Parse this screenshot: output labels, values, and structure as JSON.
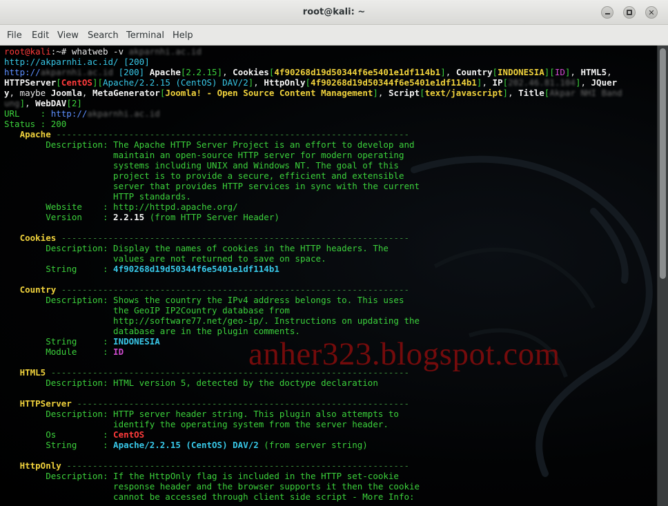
{
  "window": {
    "title": "root@kali: ~",
    "buttons": {
      "minimize": "minimize",
      "maximize": "maximize",
      "close": "✕"
    }
  },
  "menu": [
    "File",
    "Edit",
    "View",
    "Search",
    "Terminal",
    "Help"
  ],
  "watermark": "anher323.blogspot.com",
  "terminal_lines": [
    [
      [
        "r",
        "root@kali"
      ],
      [
        "w",
        ":~# whatweb -v "
      ],
      [
        "blur",
        "akparnhi.ac.id"
      ]
    ],
    [
      [
        "c",
        "http://akparnhi.ac.id/ [200]"
      ]
    ],
    [
      [
        "bl",
        "http://"
      ],
      [
        "blur",
        "akparnhi.ac.id"
      ],
      [
        "c",
        " [200] "
      ],
      [
        "wb",
        "Apache"
      ],
      [
        "g",
        "["
      ],
      [
        "g",
        "2.2.15"
      ],
      [
        "g",
        "]"
      ],
      [
        "w",
        ", "
      ],
      [
        "wb",
        "Cookies"
      ],
      [
        "g",
        "["
      ],
      [
        "yb",
        "4f90268d19d50344f6e5401e1df114b1"
      ],
      [
        "g",
        "]"
      ],
      [
        "w",
        ", "
      ],
      [
        "wb",
        "Country"
      ],
      [
        "g",
        "["
      ],
      [
        "yb",
        "INDONESIA"
      ],
      [
        "g",
        "]["
      ],
      [
        "m",
        "ID"
      ],
      [
        "g",
        "]"
      ],
      [
        "w",
        ", "
      ],
      [
        "wb",
        "HTML5"
      ],
      [
        "w",
        ","
      ]
    ],
    [
      [
        "wb",
        "HTTPServer"
      ],
      [
        "g",
        "["
      ],
      [
        "rb",
        "CentOS"
      ],
      [
        "g",
        "]["
      ],
      [
        "c",
        "Apache/2.2.15 (CentOS) DAV/2"
      ],
      [
        "g",
        "]"
      ],
      [
        "w",
        ", "
      ],
      [
        "wb",
        "HttpOnly"
      ],
      [
        "g",
        "["
      ],
      [
        "yb",
        "4f90268d19d50344f6e5401e1df114b1"
      ],
      [
        "g",
        "]"
      ],
      [
        "w",
        ", "
      ],
      [
        "wb",
        "IP"
      ],
      [
        "g",
        "["
      ],
      [
        "blur",
        "202.46.81.104"
      ],
      [
        "g",
        "]"
      ],
      [
        "w",
        ", "
      ],
      [
        "wb",
        "JQuer"
      ]
    ],
    [
      [
        "wb",
        "y"
      ],
      [
        "w",
        ", maybe "
      ],
      [
        "wb",
        "Joomla"
      ],
      [
        "w",
        ", "
      ],
      [
        "wb",
        "MetaGenerator"
      ],
      [
        "g",
        "["
      ],
      [
        "yb",
        "Joomla! - Open Source Content Management"
      ],
      [
        "g",
        "]"
      ],
      [
        "w",
        ", "
      ],
      [
        "wb",
        "Script"
      ],
      [
        "g",
        "["
      ],
      [
        "yb",
        "text/javascript"
      ],
      [
        "g",
        "]"
      ],
      [
        "w",
        ", "
      ],
      [
        "wb",
        "Title"
      ],
      [
        "g",
        "["
      ],
      [
        "blur",
        "Akpar NHI Band"
      ]
    ],
    [
      [
        "blur",
        "ung"
      ],
      [
        "g",
        "]"
      ],
      [
        "w",
        ", "
      ],
      [
        "wb",
        "WebDAV"
      ],
      [
        "g",
        "["
      ],
      [
        "g",
        "2"
      ],
      [
        "g",
        "]"
      ]
    ],
    [
      [
        "g",
        "URL    : "
      ],
      [
        "bl",
        "http://"
      ],
      [
        "blur",
        "akparnhi.ac.id"
      ]
    ],
    [
      [
        "g",
        "Status : 200"
      ]
    ],
    [
      [
        "yb",
        "   Apache "
      ],
      [
        "dash",
        "--------------------------------------------------------------------"
      ]
    ],
    [
      [
        "g",
        "        Description: The Apache HTTP Server Project is an effort to develop and"
      ]
    ],
    [
      [
        "g",
        "                     maintain an open-source HTTP server for modern operating"
      ]
    ],
    [
      [
        "g",
        "                     systems including UNIX and Windows NT. The goal of this"
      ]
    ],
    [
      [
        "g",
        "                     project is to provide a secure, efficient and extensible"
      ]
    ],
    [
      [
        "g",
        "                     server that provides HTTP services in sync with the current"
      ]
    ],
    [
      [
        "g",
        "                     HTTP standards."
      ]
    ],
    [
      [
        "g",
        "        Website    : http://httpd.apache.org/"
      ]
    ],
    [
      [
        "g",
        "        Version    : "
      ],
      [
        "wb",
        "2.2.15"
      ],
      [
        "g",
        " (from HTTP Server Header)"
      ]
    ],
    [
      [
        "g",
        ""
      ]
    ],
    [
      [
        "yb",
        "   Cookies "
      ],
      [
        "dash",
        "-------------------------------------------------------------------"
      ]
    ],
    [
      [
        "g",
        "        Description: Display the names of cookies in the HTTP headers. The"
      ]
    ],
    [
      [
        "g",
        "                     values are not returned to save on space."
      ]
    ],
    [
      [
        "g",
        "        String     : "
      ],
      [
        "cb",
        "4f90268d19d50344f6e5401e1df114b1"
      ]
    ],
    [
      [
        "g",
        ""
      ]
    ],
    [
      [
        "yb",
        "   Country "
      ],
      [
        "dash",
        "-------------------------------------------------------------------"
      ]
    ],
    [
      [
        "g",
        "        Description: Shows the country the IPv4 address belongs to. This uses"
      ]
    ],
    [
      [
        "g",
        "                     the GeoIP IP2Country database from"
      ]
    ],
    [
      [
        "g",
        "                     http://software77.net/geo-ip/. Instructions on updating the"
      ]
    ],
    [
      [
        "g",
        "                     database are in the plugin comments."
      ]
    ],
    [
      [
        "g",
        "        String     : "
      ],
      [
        "cb",
        "INDONESIA"
      ]
    ],
    [
      [
        "g",
        "        Module     : "
      ],
      [
        "mb",
        "ID"
      ]
    ],
    [
      [
        "g",
        ""
      ]
    ],
    [
      [
        "yb",
        "   HTML5 "
      ],
      [
        "dash",
        "---------------------------------------------------------------------"
      ]
    ],
    [
      [
        "g",
        "        Description: HTML version 5, detected by the doctype declaration"
      ]
    ],
    [
      [
        "g",
        ""
      ]
    ],
    [
      [
        "yb",
        "   HTTPServer "
      ],
      [
        "dash",
        "----------------------------------------------------------------"
      ]
    ],
    [
      [
        "g",
        "        Description: HTTP server header string. This plugin also attempts to"
      ]
    ],
    [
      [
        "g",
        "                     identify the operating system from the server header."
      ]
    ],
    [
      [
        "g",
        "        Os         : "
      ],
      [
        "rb",
        "CentOS"
      ]
    ],
    [
      [
        "g",
        "        String     : "
      ],
      [
        "cb",
        "Apache/2.2.15 (CentOS) DAV/2"
      ],
      [
        "g",
        " (from server string)"
      ]
    ],
    [
      [
        "g",
        ""
      ]
    ],
    [
      [
        "yb",
        "   HttpOnly "
      ],
      [
        "dash",
        "------------------------------------------------------------------"
      ]
    ],
    [
      [
        "g",
        "        Description: If the HttpOnly flag is included in the HTTP set-cookie"
      ]
    ],
    [
      [
        "g",
        "                     response header and the browser supports it then the cookie"
      ]
    ],
    [
      [
        "g",
        "                     cannot be accessed through client side script - More Info:"
      ]
    ]
  ],
  "colors": {
    "background": "#000000",
    "prompt_user": "#ff3b3b",
    "output": "#3cd23c",
    "highlight": "#f0d23c",
    "value": "#38c8e8",
    "watermark": "#7a0c0c"
  }
}
